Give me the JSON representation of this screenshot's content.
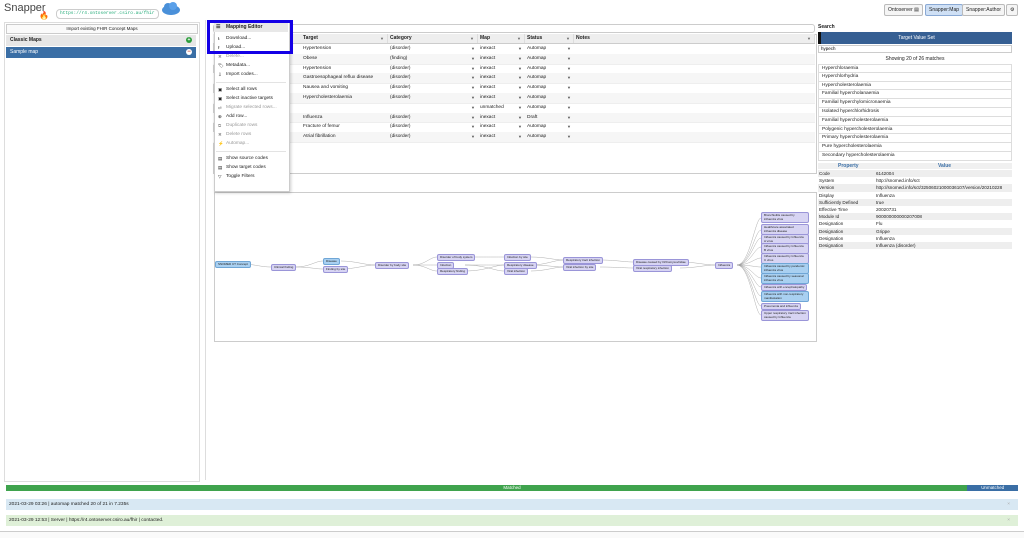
{
  "header": {
    "app_name": "Snapper",
    "url": "https://r4.ontoserver.csiro.au/fhir",
    "buttons": [
      "Ontoserver",
      "Snapper:Map",
      "Snapper:Author"
    ],
    "settings_icon": "gear-icon"
  },
  "left": {
    "import_label": "Import existing FHIR Concept Maps",
    "section_title": "Classic Maps",
    "maps": [
      "Sample map"
    ]
  },
  "menu": {
    "title": "Mapping Editor",
    "items": [
      {
        "label": "Download...",
        "icon": "download-icon",
        "disabled": false
      },
      {
        "label": "Upload...",
        "icon": "upload-icon",
        "disabled": false
      },
      {
        "label": "Delete...",
        "icon": "trash-icon",
        "disabled": true
      },
      {
        "label": "Metadata...",
        "icon": "tag-icon",
        "disabled": false
      },
      {
        "label": "Import codes...",
        "icon": "import-icon",
        "disabled": false
      },
      {
        "label": "Select all rows",
        "icon": "select-all-icon",
        "disabled": false
      },
      {
        "label": "Select inactive targets",
        "icon": "select-inactive-icon",
        "disabled": false
      },
      {
        "label": "Migrate selected rows...",
        "icon": "migrate-icon",
        "disabled": true
      },
      {
        "label": "Add row...",
        "icon": "plus-icon",
        "disabled": false
      },
      {
        "label": "Duplicate rows",
        "icon": "duplicate-icon",
        "disabled": true
      },
      {
        "label": "Delete rows",
        "icon": "delete-rows-icon",
        "disabled": true
      },
      {
        "label": "Automap...",
        "icon": "automap-icon",
        "disabled": true
      },
      {
        "label": "Show source codes",
        "icon": "show-source-icon",
        "disabled": false
      },
      {
        "label": "Show target codes",
        "icon": "show-target-icon",
        "disabled": false
      },
      {
        "label": "Toggle Filters",
        "icon": "filter-icon",
        "disabled": false
      }
    ]
  },
  "grid": {
    "columns": [
      "Target",
      "Category",
      "Map",
      "Status",
      "Notes"
    ],
    "rows": [
      [
        "Hypertension",
        "(disorder)",
        "inexact",
        "Automap",
        ""
      ],
      [
        "Obese",
        "(finding)",
        "inexact",
        "Automap",
        ""
      ],
      [
        "Hypertension",
        "(disorder)",
        "inexact",
        "Automap",
        ""
      ],
      [
        "Gastroesophageal reflux disease",
        "(disorder)",
        "inexact",
        "Automap",
        ""
      ],
      [
        "Nausea and vomiting",
        "(disorder)",
        "inexact",
        "Automap",
        ""
      ],
      [
        "Hypercholesterolaemia",
        "(disorder)",
        "inexact",
        "Automap",
        ""
      ],
      [
        "",
        "",
        "unmatched",
        "Automap",
        ""
      ],
      [
        "Influenza",
        "(disorder)",
        "inexact",
        "Draft",
        ""
      ],
      [
        "Fracture of femur",
        "(disorder)",
        "inexact",
        "Automap",
        ""
      ],
      [
        "Atrial fibrillation",
        "(disorder)",
        "inexact",
        "Automap",
        ""
      ]
    ],
    "summary": "elected: 0"
  },
  "graph": {
    "nodes": [
      "SNOMED CT Concept",
      "Clinical finding",
      "Disease",
      "Finding by site",
      "Disorder by body site",
      "Disorder of body system",
      "Infection",
      "Respiratory finding",
      "Infection by site",
      "Respiratory disease",
      "Viral infection",
      "Respiratory tract infection",
      "Viral infection by site",
      "Disease caused by Orthomyxoviridae",
      "Viral respiratory infection",
      "Influenza",
      "Bronchiolitis caused by influenza virus",
      "Healthcare associated influenza disease",
      "Influenza caused by Influenza A virus",
      "Influenza caused by Influenza B virus",
      "Influenza caused by Influenza C virus",
      "Influenza caused by pandemic influenza virus",
      "Influenza caused by seasonal influenza virus",
      "Influenza with encephalopathy",
      "Influenza with non-respiratory manifestation",
      "Pneumonia and influenza",
      "Upper respiratory tract infection caused by Influenza"
    ]
  },
  "right": {
    "title": "Search",
    "button": "Target Value Set",
    "query": "hypech",
    "count": "Showing 20 of 26 matches",
    "matches": [
      "Hyperchloraemia",
      "Hyperchlorhydria",
      "Hypercholesterolaemia",
      "Familial hypercholanaemia",
      "Familial hyperchylomicronaemia",
      "Isolated hyperchlorhidrosis",
      "Familial hypercholesterolaemia",
      "Polygenic hypercholesterolaemia",
      "Primary hypercholesterolaemia",
      "Pure hypercholesterolaemia",
      "Secondary hypercholesterolaemia"
    ],
    "prop_headers": [
      "Property",
      "Value"
    ],
    "properties": [
      [
        "Code",
        "6142004"
      ],
      [
        "System",
        "http://snomed.info/sct"
      ],
      [
        "Version",
        "http://snomed.info/sct/32506021000036107/version/20210228"
      ],
      [
        "Display",
        "Influenza"
      ],
      [
        "Sufficiently Defined",
        "true"
      ],
      [
        "Effective Time",
        "20020731"
      ],
      [
        "Module Id",
        "900000000000207008"
      ],
      [
        "Designation",
        "Flu"
      ],
      [
        "Designation",
        "Grippe"
      ],
      [
        "Designation",
        "Influenza"
      ],
      [
        "Designation",
        "Influenza (disorder)"
      ]
    ]
  },
  "progress": {
    "matched_label": "Matched",
    "unmatched_label": "Unmatched",
    "matched_fraction": 0.95
  },
  "status": [
    {
      "text": "2021-03-29 03:26 | automap matched 20 of 21 in 7.235s",
      "color": "#d8e8f3"
    },
    {
      "text": "2021-03-29 12:53 | Server | https://r4.ontoserver.csiro.au/fhir | contacted.",
      "color": "#dff0d8"
    }
  ]
}
